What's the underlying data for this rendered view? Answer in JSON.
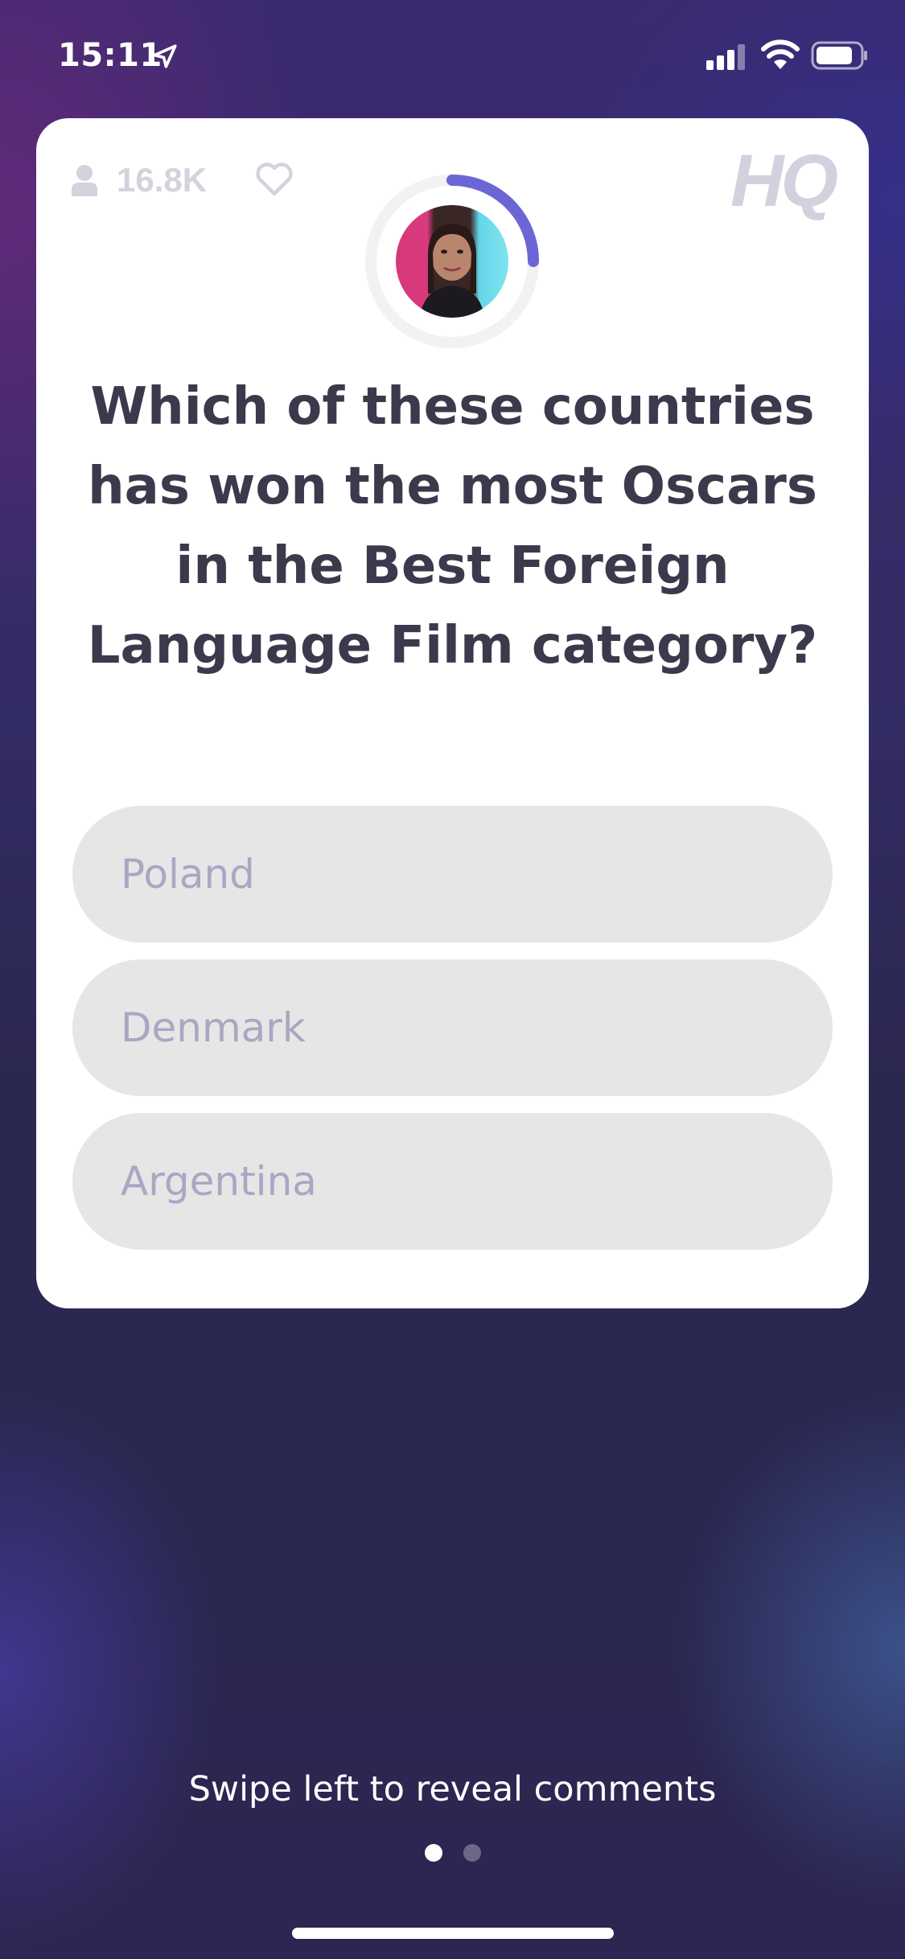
{
  "status_bar": {
    "time": "15:11",
    "icons": [
      "location-arrow-icon",
      "cellular-signal-icon",
      "wifi-icon",
      "battery-icon"
    ]
  },
  "card": {
    "viewer_count": "16.8K",
    "logo_text": "HQ",
    "icons": [
      "person-icon",
      "heart-icon"
    ],
    "timer_progress": 0.25,
    "question": "Which of these countries has won the most Oscars in the Best Foreign Language Film category?",
    "answers": [
      {
        "label": "Poland"
      },
      {
        "label": "Denmark"
      },
      {
        "label": "Argentina"
      }
    ]
  },
  "footer": {
    "hint": "Swipe left to reveal comments",
    "page_count": 2,
    "active_page": 1
  },
  "colors": {
    "accent": "#6b66d6",
    "question_text": "#3a3a4c",
    "answer_bg": "#e6e6e6",
    "answer_text": "#a9a7c3",
    "muted": "#d3d3de"
  }
}
